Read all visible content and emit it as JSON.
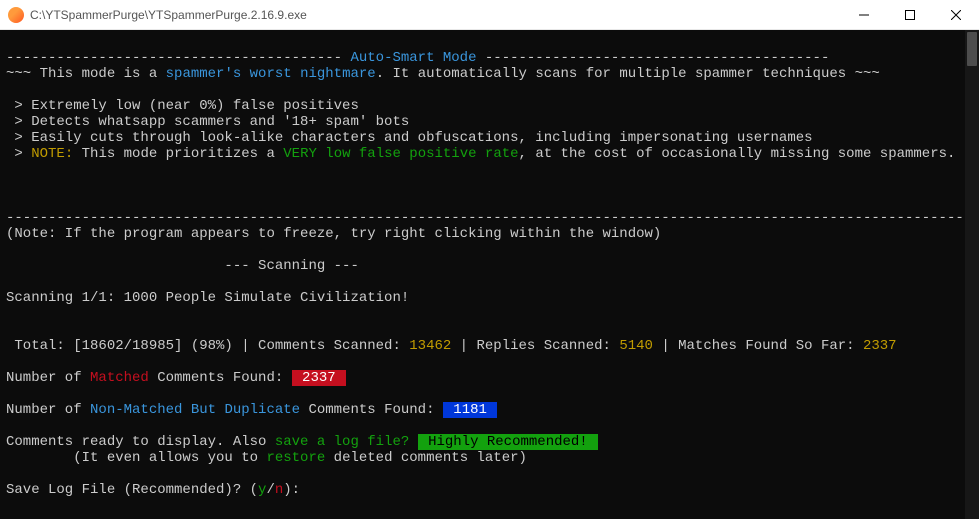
{
  "title": "C:\\YTSpammerPurge\\YTSpammerPurge.2.16.9.exe",
  "header": {
    "dash_prefix": "---------------------------------------- ",
    "mode_title": "Auto-Smart Mode",
    "dash_suffix": " -----------------------------------------",
    "intro_prefix": "~~~ This mode is a ",
    "nightmare": "spammer's worst nightmare",
    "intro_suffix": ". It automatically scans for multiple spammer techniques ~~~"
  },
  "bullets": {
    "b1": " > Extremely low (near 0%) false positives",
    "b2": " > Detects whatsapp scammers and '18+ spam' bots",
    "b3": " > Easily cuts through look-alike characters and obfuscations, including impersonating usernames",
    "b4_prefix": " >",
    "b4_note": " NOTE:",
    "b4_mid": " This mode prioritizes a ",
    "b4_green": "VERY low false positive rate",
    "b4_suffix": ", at the cost of occasionally missing some spammers."
  },
  "divider": "--------------------------------------------------------------------------------------------------------------------------",
  "freeze_note": "(Note: If the program appears to freeze, try right clicking within the window)",
  "scanning_label": "                          --- Scanning ---",
  "scanning_line": "Scanning 1/1: 1000 People Simulate Civilization!",
  "stats": {
    "prefix": " Total: [18602/18985] (98%) | Comments Scanned: ",
    "comments": "13462",
    "mid1": " | Replies Scanned: ",
    "replies": "5140",
    "mid2": " | Matches Found So Far: ",
    "matches": "2337"
  },
  "matched": {
    "prefix": "Number of ",
    "label": "Matched",
    "mid": " Comments Found: ",
    "value": " 2337 "
  },
  "nonmatched": {
    "prefix": "Number of ",
    "label": "Non-Matched But Duplicate",
    "mid": " Comments Found: ",
    "value": " 1181 "
  },
  "ready": {
    "prefix": "Comments ready to display. Also ",
    "green1": "save a log file?",
    "space": " ",
    "badge": " Highly Recommended! "
  },
  "restore": {
    "prefix": "        (It even allows you to ",
    "green": "restore",
    "suffix": " deleted comments later)"
  },
  "prompt": {
    "prefix": "Save Log File (Recommended)? (",
    "y": "y",
    "slash": "/",
    "n": "n",
    "suffix": "):"
  }
}
